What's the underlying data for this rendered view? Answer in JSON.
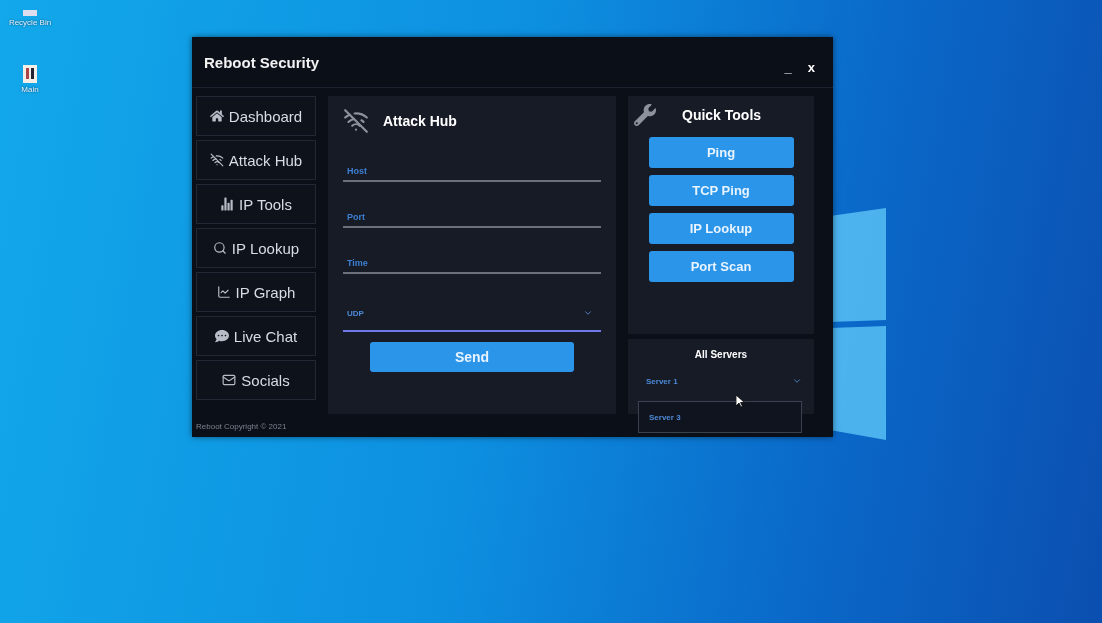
{
  "desktop_icons": [
    {
      "label": "Recycle Bin"
    },
    {
      "label": "Main"
    }
  ],
  "window": {
    "title": "Reboot Security",
    "controls": [
      "_",
      "x"
    ]
  },
  "sidebar": {
    "items": [
      {
        "label": "Dashboard"
      },
      {
        "label": "Attack Hub"
      },
      {
        "label": "IP Tools"
      },
      {
        "label": "IP Lookup"
      },
      {
        "label": "IP Graph"
      },
      {
        "label": "Live Chat"
      },
      {
        "label": "Socials"
      }
    ]
  },
  "attack_hub": {
    "title": "Attack Hub",
    "fields": [
      {
        "placeholder": "Host"
      },
      {
        "placeholder": "Port"
      },
      {
        "placeholder": "Time"
      }
    ],
    "method": {
      "value": "UDP"
    },
    "send_button": "Send"
  },
  "quick_tools": {
    "title": "Quick Tools",
    "buttons": [
      "Ping",
      "TCP Ping",
      "IP Lookup",
      "Port Scan"
    ]
  },
  "servers": {
    "title": "All Servers",
    "select": {
      "value": "Server 1",
      "expanded": true,
      "options": [
        "Server 3"
      ]
    }
  },
  "footer": "Reboot Copyright © 2021"
}
